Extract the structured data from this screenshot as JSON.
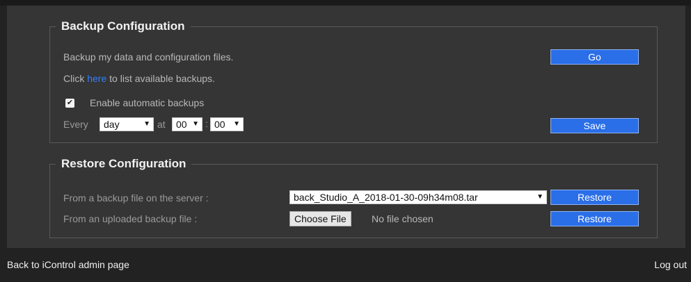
{
  "backup": {
    "legend": "Backup Configuration",
    "description": "Backup my data and configuration files.",
    "go_label": "Go",
    "list_prefix": "Click ",
    "list_link": "here",
    "list_suffix": " to list available backups.",
    "auto_checked": true,
    "auto_label": "Enable automatic backups",
    "every_label": "Every",
    "period_value": "day",
    "at_label": "at",
    "hour_value": "00",
    "colon": ":",
    "minute_value": "00",
    "save_label": "Save"
  },
  "restore": {
    "legend": "Restore Configuration",
    "server_label": "From a backup file on the server :",
    "server_file_value": "back_Studio_A_2018-01-30-09h34m08.tar",
    "server_restore_label": "Restore",
    "upload_label": "From an uploaded backup file :",
    "choose_file_label": "Choose File",
    "no_file_text": "No file chosen",
    "upload_restore_label": "Restore"
  },
  "footer": {
    "back_link": "Back to iControl admin page",
    "logout_link": "Log out"
  },
  "icons": {
    "dropdown": "chevron-down-icon",
    "check": "checkmark-icon"
  }
}
